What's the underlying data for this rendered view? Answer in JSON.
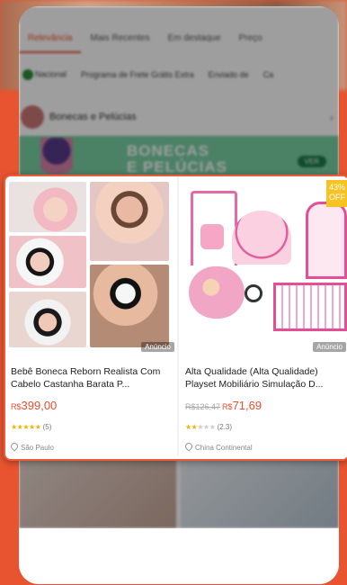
{
  "background": {
    "accent": "#e8542f"
  },
  "tabs": [
    {
      "label": "Relevância",
      "active": true
    },
    {
      "label": "Mais Recentes"
    },
    {
      "label": "Em destaque"
    },
    {
      "label": "Preço"
    }
  ],
  "filters": [
    {
      "label": "Nacional",
      "icon": "flag-icon"
    },
    {
      "label": "Programa de Frete Grátis Extra"
    },
    {
      "label": "Enviado de"
    },
    {
      "label": "Ca"
    }
  ],
  "category": {
    "label": "Bonecas e Pelúcias"
  },
  "banner": {
    "line1": "BONECAS",
    "line2": "E PELÚCIAS",
    "cta": "VER"
  },
  "products": [
    {
      "title": "Bebê Boneca Reborn Realista Com Cabelo Castanha Barata P...",
      "price_prefix": "R$",
      "price": "399,00",
      "rating_stars": 5,
      "rating_count": "(5)",
      "location": "São Paulo",
      "ad_label": "Anúncio"
    },
    {
      "title": "Alta Qualidade (Alta Qualidade) Playset Mobiliário Simulação D...",
      "price_original": "R$126,47",
      "price_prefix": "R$",
      "price": "71,69",
      "discount": "43%",
      "discount_suffix": "OFF",
      "rating_stars": 2,
      "rating_count": "(2.3)",
      "location": "China Continental",
      "ad_label": "Anúncio"
    }
  ]
}
